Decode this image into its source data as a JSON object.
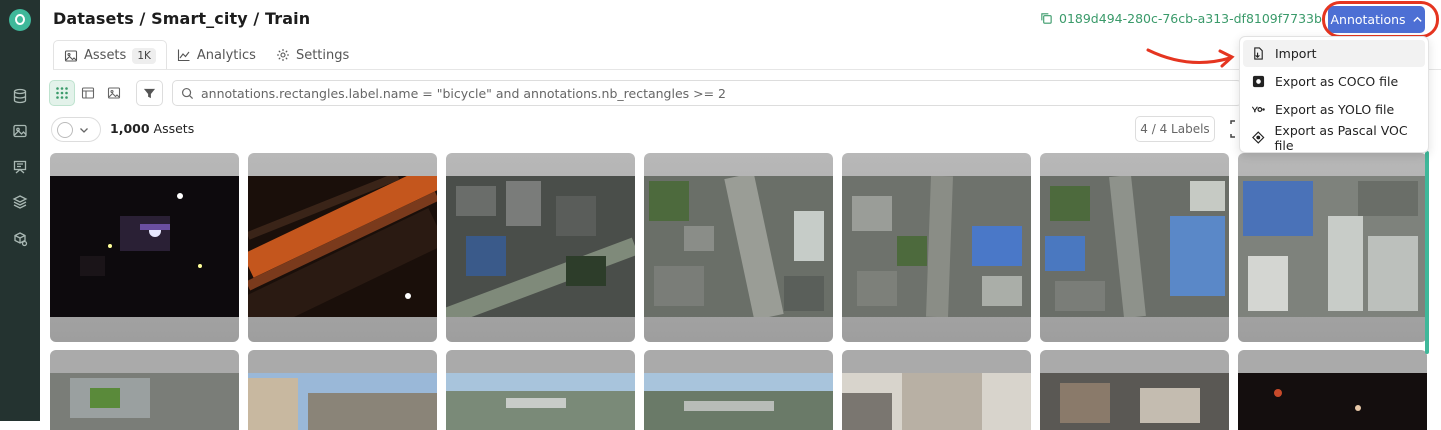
{
  "header": {
    "breadcrumb": "Datasets / Smart_city / Train",
    "dataset_id": "0189d494-280c-76cb-a313-df8109f7733b",
    "annotations_label": "Annotations"
  },
  "tabs": [
    {
      "label": "Assets",
      "count": "1K",
      "icon": "image-icon",
      "active": true
    },
    {
      "label": "Analytics",
      "icon": "chart-line-icon",
      "active": false
    },
    {
      "label": "Settings",
      "icon": "gear-icon",
      "active": false
    }
  ],
  "toolbar": {
    "search_query": "annotations.rectangles.label.name = \"bicycle\" and annotations.nb_rectangles >= 2",
    "view_modes": [
      "grid-view-icon",
      "table-view-icon",
      "single-image-icon"
    ],
    "filter_icon": "filter-icon"
  },
  "assets_bar": {
    "count_value": "1,000",
    "count_label": "Assets",
    "labels_badge": "4 / 4 Labels"
  },
  "dropdown": {
    "items": [
      {
        "label": "Import",
        "icon": "import-file-icon"
      },
      {
        "label": "Export as COCO file",
        "icon": "coco-icon"
      },
      {
        "label": "Export as YOLO file",
        "icon": "yolo-icon"
      },
      {
        "label": "Export as Pascal VOC file",
        "icon": "pascal-voc-icon"
      }
    ]
  },
  "sidebar": {
    "items": [
      "database-icon",
      "image-icon",
      "model-icon",
      "layers-icon",
      "deploy-icon"
    ]
  },
  "colors": {
    "accent": "#4d6fd4",
    "brand": "#3fb89a",
    "sidebar_bg": "#243330",
    "highlight": "#e53520"
  }
}
